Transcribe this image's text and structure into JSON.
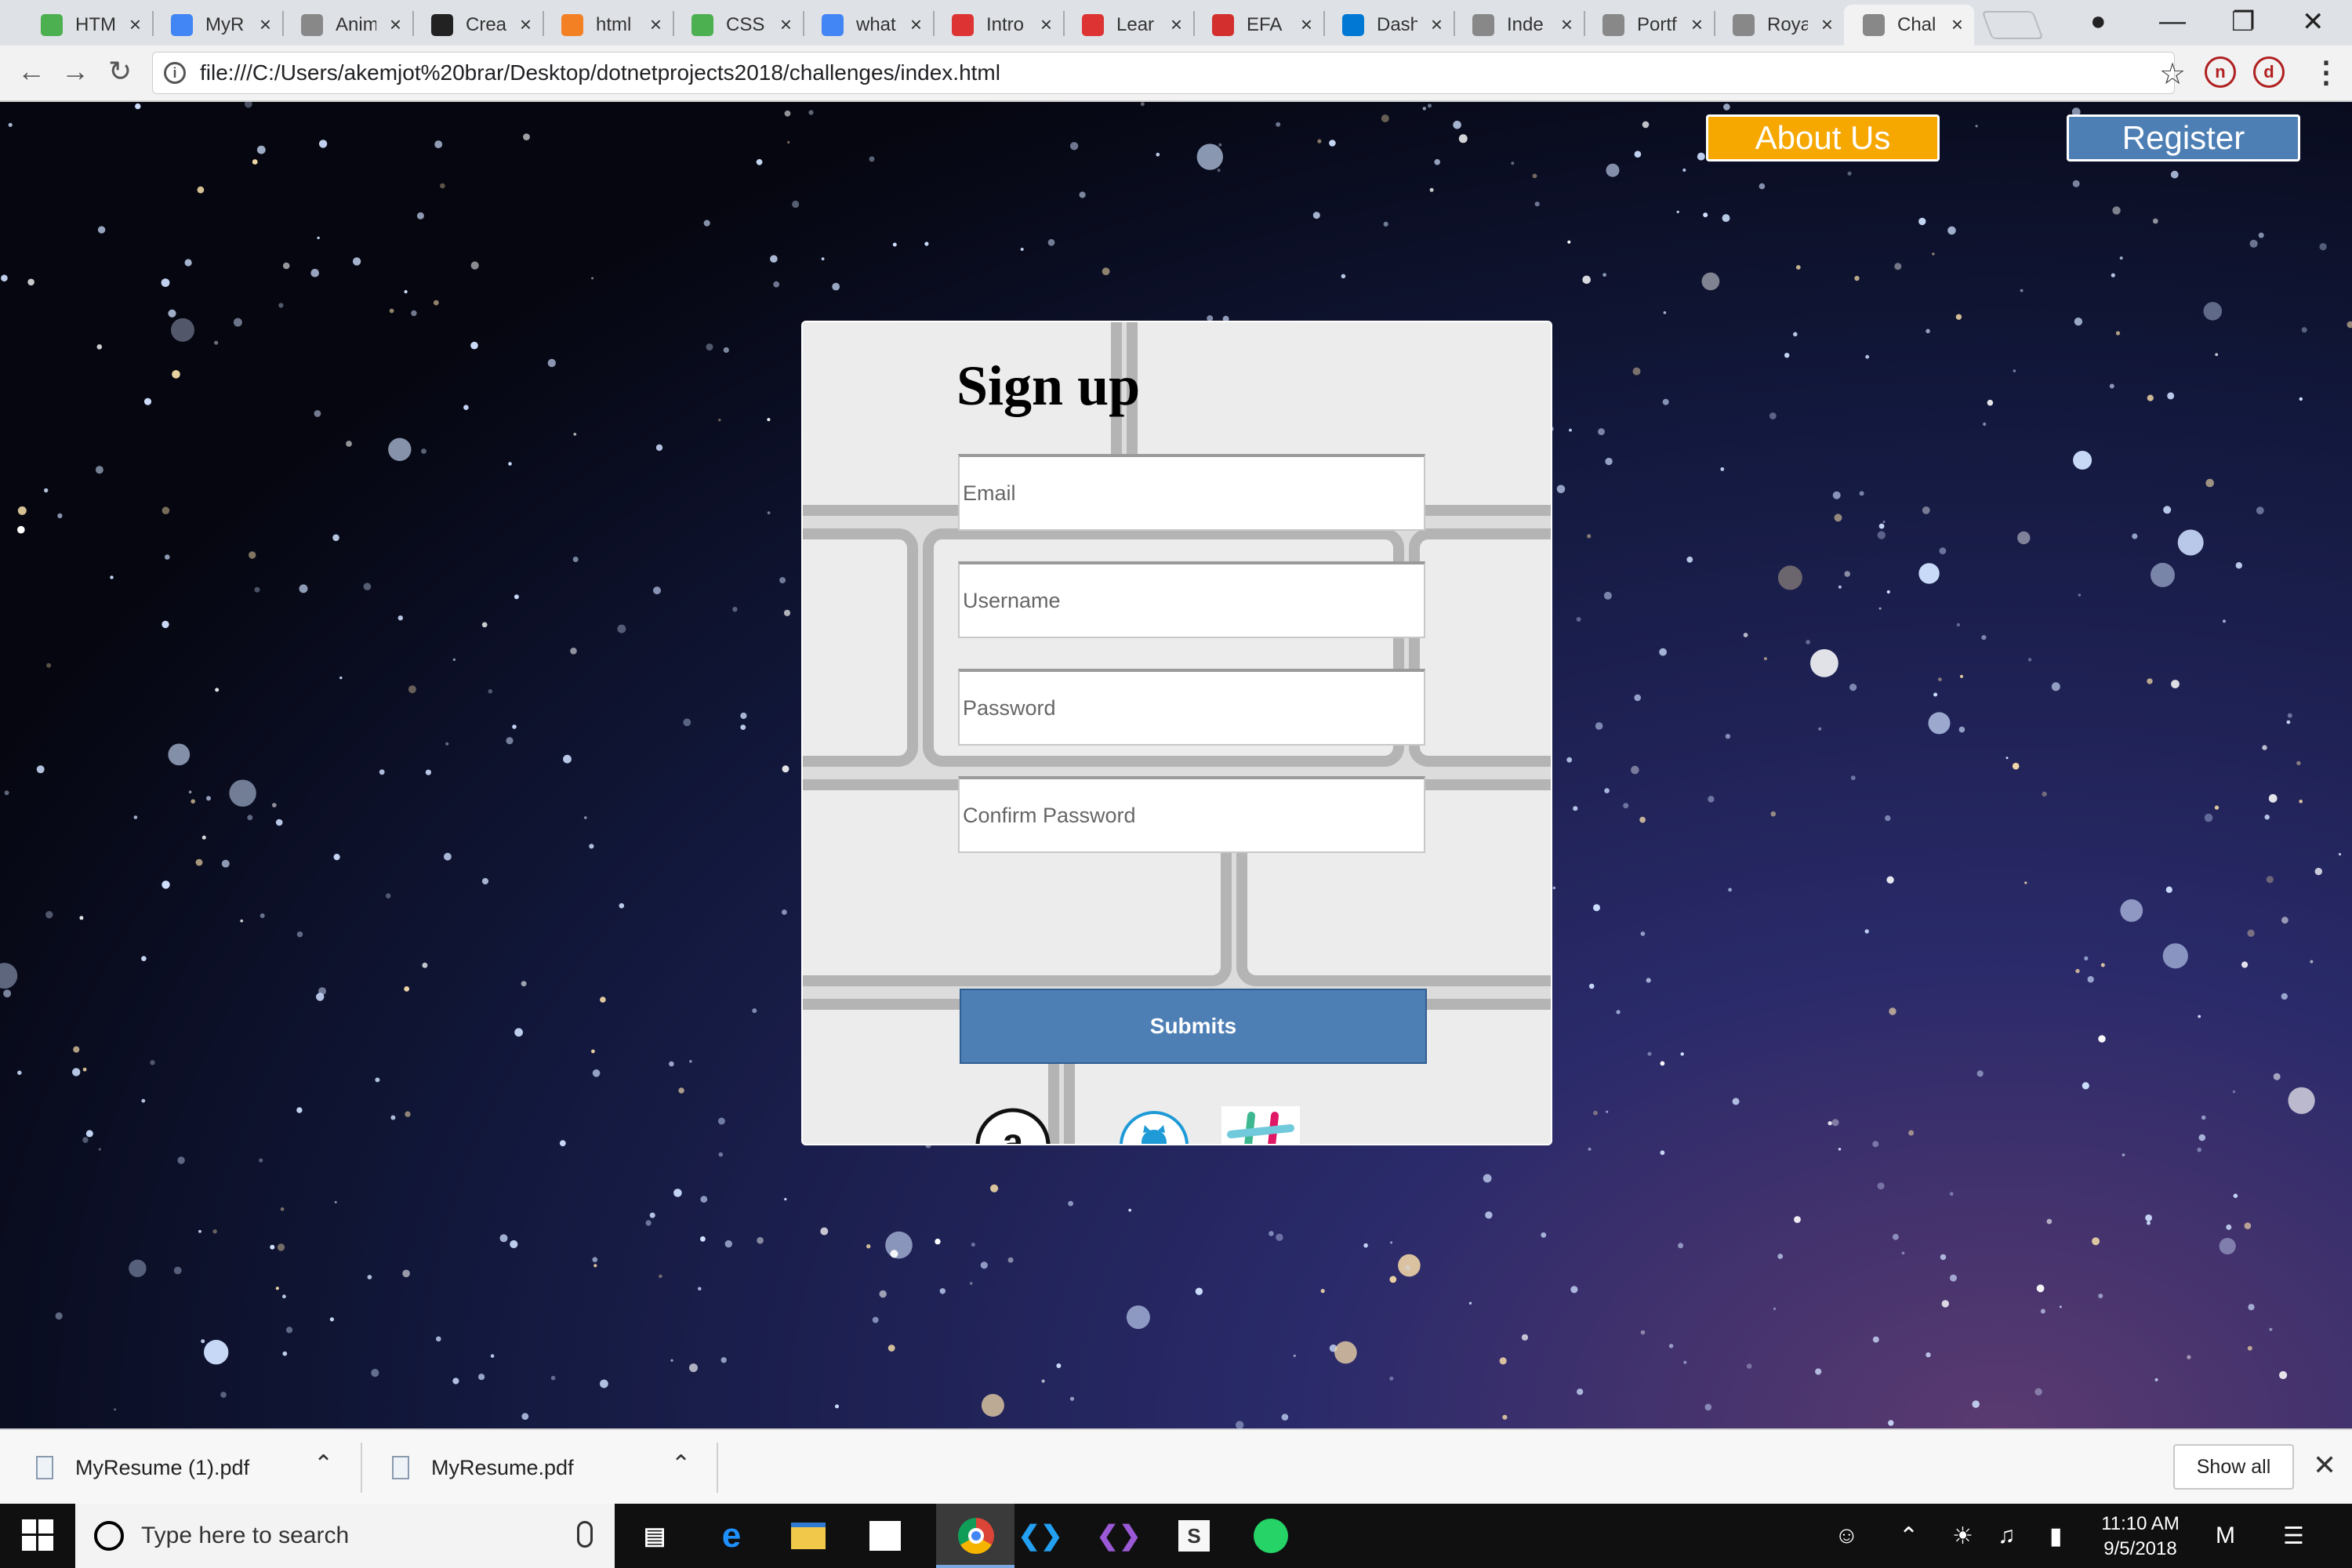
{
  "browser": {
    "tabs": [
      {
        "label": "HTM",
        "favicon": "w3schools-icon",
        "color": "#4caf50"
      },
      {
        "label": "MyR",
        "favicon": "google-docs-icon",
        "color": "#4285f4"
      },
      {
        "label": "Anim",
        "favicon": "page-icon",
        "color": "#888888"
      },
      {
        "label": "Crea",
        "favicon": "codepen-icon",
        "color": "#222222"
      },
      {
        "label": "html",
        "favicon": "stackoverflow-icon",
        "color": "#f48024"
      },
      {
        "label": "CSS",
        "favicon": "w3schools-icon",
        "color": "#4caf50"
      },
      {
        "label": "what",
        "favicon": "google-icon",
        "color": "#4285f4"
      },
      {
        "label": "Intro",
        "favicon": "angular-icon",
        "color": "#dd3333"
      },
      {
        "label": "Lear",
        "favicon": "angular-icon",
        "color": "#dd3333"
      },
      {
        "label": "EFA",
        "favicon": "shield-icon",
        "color": "#d32f2f"
      },
      {
        "label": "Dash",
        "favicon": "azure-icon",
        "color": "#0078d4"
      },
      {
        "label": "Inde",
        "favicon": "page-icon",
        "color": "#888888"
      },
      {
        "label": "Portf",
        "favicon": "page-icon",
        "color": "#888888"
      },
      {
        "label": "Roya",
        "favicon": "page-icon",
        "color": "#888888"
      },
      {
        "label": "Chal",
        "favicon": "page-icon",
        "color": "#888888",
        "active": true
      }
    ],
    "url": "file:///C:/Users/akemjot%20brar/Desktop/dotnetprojects2018/challenges/index.html",
    "extensions": [
      "n",
      "d"
    ]
  },
  "page": {
    "about_label": "About Us",
    "register_label": "Register",
    "signup_title": "Sign up",
    "fields": {
      "email_placeholder": "Email",
      "username_placeholder": "Username",
      "password_placeholder": "Password",
      "confirm_placeholder": "Confirm Password"
    },
    "submit_label": "Submits",
    "social_icons": [
      "amazon-icon",
      "github-icon",
      "slack-icon"
    ],
    "colors": {
      "about": "#f6a700",
      "register": "#4d7fb5",
      "submit": "#4d7fb5"
    }
  },
  "downloads": {
    "items": [
      "MyResume (1).pdf",
      "MyResume.pdf"
    ],
    "show_all": "Show all"
  },
  "taskbar": {
    "search_placeholder": "Type here to search",
    "time": "11:10 AM",
    "date": "9/5/2018"
  }
}
